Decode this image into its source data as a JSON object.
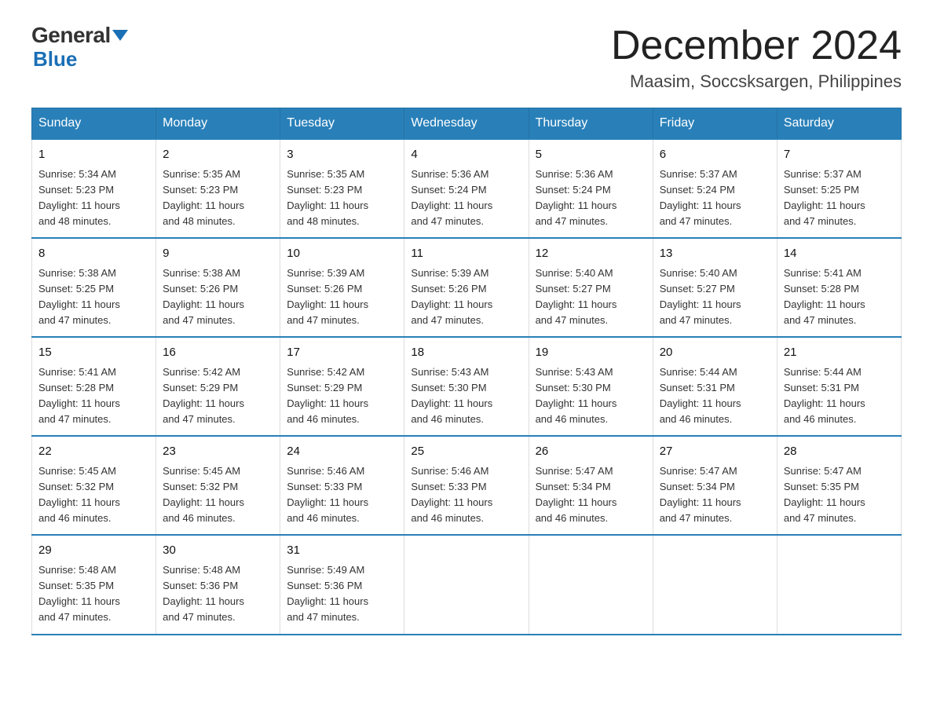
{
  "logo": {
    "general": "General",
    "triangle": "",
    "blue": "Blue"
  },
  "title": "December 2024",
  "location": "Maasim, Soccsksargen, Philippines",
  "days_of_week": [
    "Sunday",
    "Monday",
    "Tuesday",
    "Wednesday",
    "Thursday",
    "Friday",
    "Saturday"
  ],
  "weeks": [
    [
      {
        "day": "1",
        "sunrise": "5:34 AM",
        "sunset": "5:23 PM",
        "daylight": "11 hours and 48 minutes."
      },
      {
        "day": "2",
        "sunrise": "5:35 AM",
        "sunset": "5:23 PM",
        "daylight": "11 hours and 48 minutes."
      },
      {
        "day": "3",
        "sunrise": "5:35 AM",
        "sunset": "5:23 PM",
        "daylight": "11 hours and 48 minutes."
      },
      {
        "day": "4",
        "sunrise": "5:36 AM",
        "sunset": "5:24 PM",
        "daylight": "11 hours and 47 minutes."
      },
      {
        "day": "5",
        "sunrise": "5:36 AM",
        "sunset": "5:24 PM",
        "daylight": "11 hours and 47 minutes."
      },
      {
        "day": "6",
        "sunrise": "5:37 AM",
        "sunset": "5:24 PM",
        "daylight": "11 hours and 47 minutes."
      },
      {
        "day": "7",
        "sunrise": "5:37 AM",
        "sunset": "5:25 PM",
        "daylight": "11 hours and 47 minutes."
      }
    ],
    [
      {
        "day": "8",
        "sunrise": "5:38 AM",
        "sunset": "5:25 PM",
        "daylight": "11 hours and 47 minutes."
      },
      {
        "day": "9",
        "sunrise": "5:38 AM",
        "sunset": "5:26 PM",
        "daylight": "11 hours and 47 minutes."
      },
      {
        "day": "10",
        "sunrise": "5:39 AM",
        "sunset": "5:26 PM",
        "daylight": "11 hours and 47 minutes."
      },
      {
        "day": "11",
        "sunrise": "5:39 AM",
        "sunset": "5:26 PM",
        "daylight": "11 hours and 47 minutes."
      },
      {
        "day": "12",
        "sunrise": "5:40 AM",
        "sunset": "5:27 PM",
        "daylight": "11 hours and 47 minutes."
      },
      {
        "day": "13",
        "sunrise": "5:40 AM",
        "sunset": "5:27 PM",
        "daylight": "11 hours and 47 minutes."
      },
      {
        "day": "14",
        "sunrise": "5:41 AM",
        "sunset": "5:28 PM",
        "daylight": "11 hours and 47 minutes."
      }
    ],
    [
      {
        "day": "15",
        "sunrise": "5:41 AM",
        "sunset": "5:28 PM",
        "daylight": "11 hours and 47 minutes."
      },
      {
        "day": "16",
        "sunrise": "5:42 AM",
        "sunset": "5:29 PM",
        "daylight": "11 hours and 47 minutes."
      },
      {
        "day": "17",
        "sunrise": "5:42 AM",
        "sunset": "5:29 PM",
        "daylight": "11 hours and 46 minutes."
      },
      {
        "day": "18",
        "sunrise": "5:43 AM",
        "sunset": "5:30 PM",
        "daylight": "11 hours and 46 minutes."
      },
      {
        "day": "19",
        "sunrise": "5:43 AM",
        "sunset": "5:30 PM",
        "daylight": "11 hours and 46 minutes."
      },
      {
        "day": "20",
        "sunrise": "5:44 AM",
        "sunset": "5:31 PM",
        "daylight": "11 hours and 46 minutes."
      },
      {
        "day": "21",
        "sunrise": "5:44 AM",
        "sunset": "5:31 PM",
        "daylight": "11 hours and 46 minutes."
      }
    ],
    [
      {
        "day": "22",
        "sunrise": "5:45 AM",
        "sunset": "5:32 PM",
        "daylight": "11 hours and 46 minutes."
      },
      {
        "day": "23",
        "sunrise": "5:45 AM",
        "sunset": "5:32 PM",
        "daylight": "11 hours and 46 minutes."
      },
      {
        "day": "24",
        "sunrise": "5:46 AM",
        "sunset": "5:33 PM",
        "daylight": "11 hours and 46 minutes."
      },
      {
        "day": "25",
        "sunrise": "5:46 AM",
        "sunset": "5:33 PM",
        "daylight": "11 hours and 46 minutes."
      },
      {
        "day": "26",
        "sunrise": "5:47 AM",
        "sunset": "5:34 PM",
        "daylight": "11 hours and 46 minutes."
      },
      {
        "day": "27",
        "sunrise": "5:47 AM",
        "sunset": "5:34 PM",
        "daylight": "11 hours and 47 minutes."
      },
      {
        "day": "28",
        "sunrise": "5:47 AM",
        "sunset": "5:35 PM",
        "daylight": "11 hours and 47 minutes."
      }
    ],
    [
      {
        "day": "29",
        "sunrise": "5:48 AM",
        "sunset": "5:35 PM",
        "daylight": "11 hours and 47 minutes."
      },
      {
        "day": "30",
        "sunrise": "5:48 AM",
        "sunset": "5:36 PM",
        "daylight": "11 hours and 47 minutes."
      },
      {
        "day": "31",
        "sunrise": "5:49 AM",
        "sunset": "5:36 PM",
        "daylight": "11 hours and 47 minutes."
      },
      null,
      null,
      null,
      null
    ]
  ],
  "labels": {
    "sunrise": "Sunrise: ",
    "sunset": "Sunset: ",
    "daylight": "Daylight: "
  }
}
